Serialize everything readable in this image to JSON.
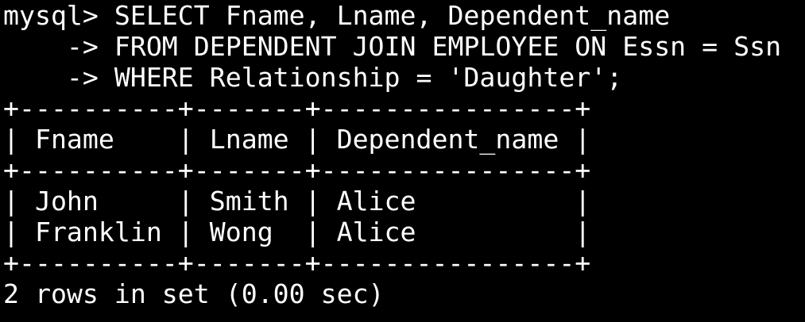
{
  "terminal": {
    "lines": [
      "mysql> SELECT Fname, Lname, Dependent_name",
      "    -> FROM DEPENDENT JOIN EMPLOYEE ON Essn = Ssn",
      "    -> WHERE Relationship = 'Daughter';",
      "+----------+-------+----------------+",
      "| Fname    | Lname | Dependent_name |",
      "+----------+-------+----------------+",
      "| John     | Smith | Alice          |",
      "| Franklin | Wong  | Alice          |",
      "+----------+-------+----------------+",
      "2 rows in set (0.00 sec)"
    ]
  }
}
